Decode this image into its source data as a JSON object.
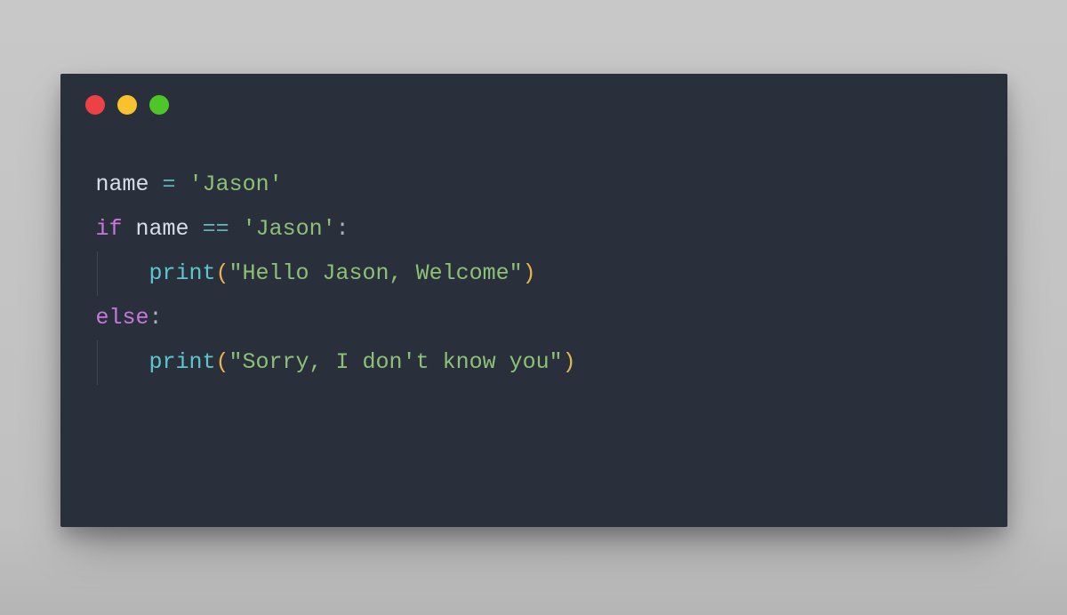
{
  "window": {
    "traffic_lights": {
      "close": "close",
      "minimize": "minimize",
      "maximize": "maximize"
    }
  },
  "code": {
    "language": "python",
    "lines": [
      {
        "indent": 0,
        "tokens": [
          {
            "text": "name",
            "type": "var"
          },
          {
            "text": " ",
            "type": "plain"
          },
          {
            "text": "=",
            "type": "op"
          },
          {
            "text": " ",
            "type": "plain"
          },
          {
            "text": "'Jason'",
            "type": "string"
          }
        ]
      },
      {
        "indent": 0,
        "tokens": [
          {
            "text": "if",
            "type": "keyword"
          },
          {
            "text": " ",
            "type": "plain"
          },
          {
            "text": "name",
            "type": "var"
          },
          {
            "text": " ",
            "type": "plain"
          },
          {
            "text": "==",
            "type": "op"
          },
          {
            "text": " ",
            "type": "plain"
          },
          {
            "text": "'Jason'",
            "type": "string"
          },
          {
            "text": ":",
            "type": "colon"
          }
        ]
      },
      {
        "indent": 1,
        "tokens": [
          {
            "text": "print",
            "type": "builtin"
          },
          {
            "text": "(",
            "type": "punct"
          },
          {
            "text": "\"Hello Jason, Welcome\"",
            "type": "string"
          },
          {
            "text": ")",
            "type": "punct"
          }
        ]
      },
      {
        "indent": 0,
        "tokens": [
          {
            "text": "else",
            "type": "keyword"
          },
          {
            "text": ":",
            "type": "colon"
          }
        ]
      },
      {
        "indent": 1,
        "tokens": [
          {
            "text": "print",
            "type": "builtin"
          },
          {
            "text": "(",
            "type": "punct"
          },
          {
            "text": "\"Sorry, I don't know you\"",
            "type": "string"
          },
          {
            "text": ")",
            "type": "punct"
          }
        ]
      }
    ]
  }
}
